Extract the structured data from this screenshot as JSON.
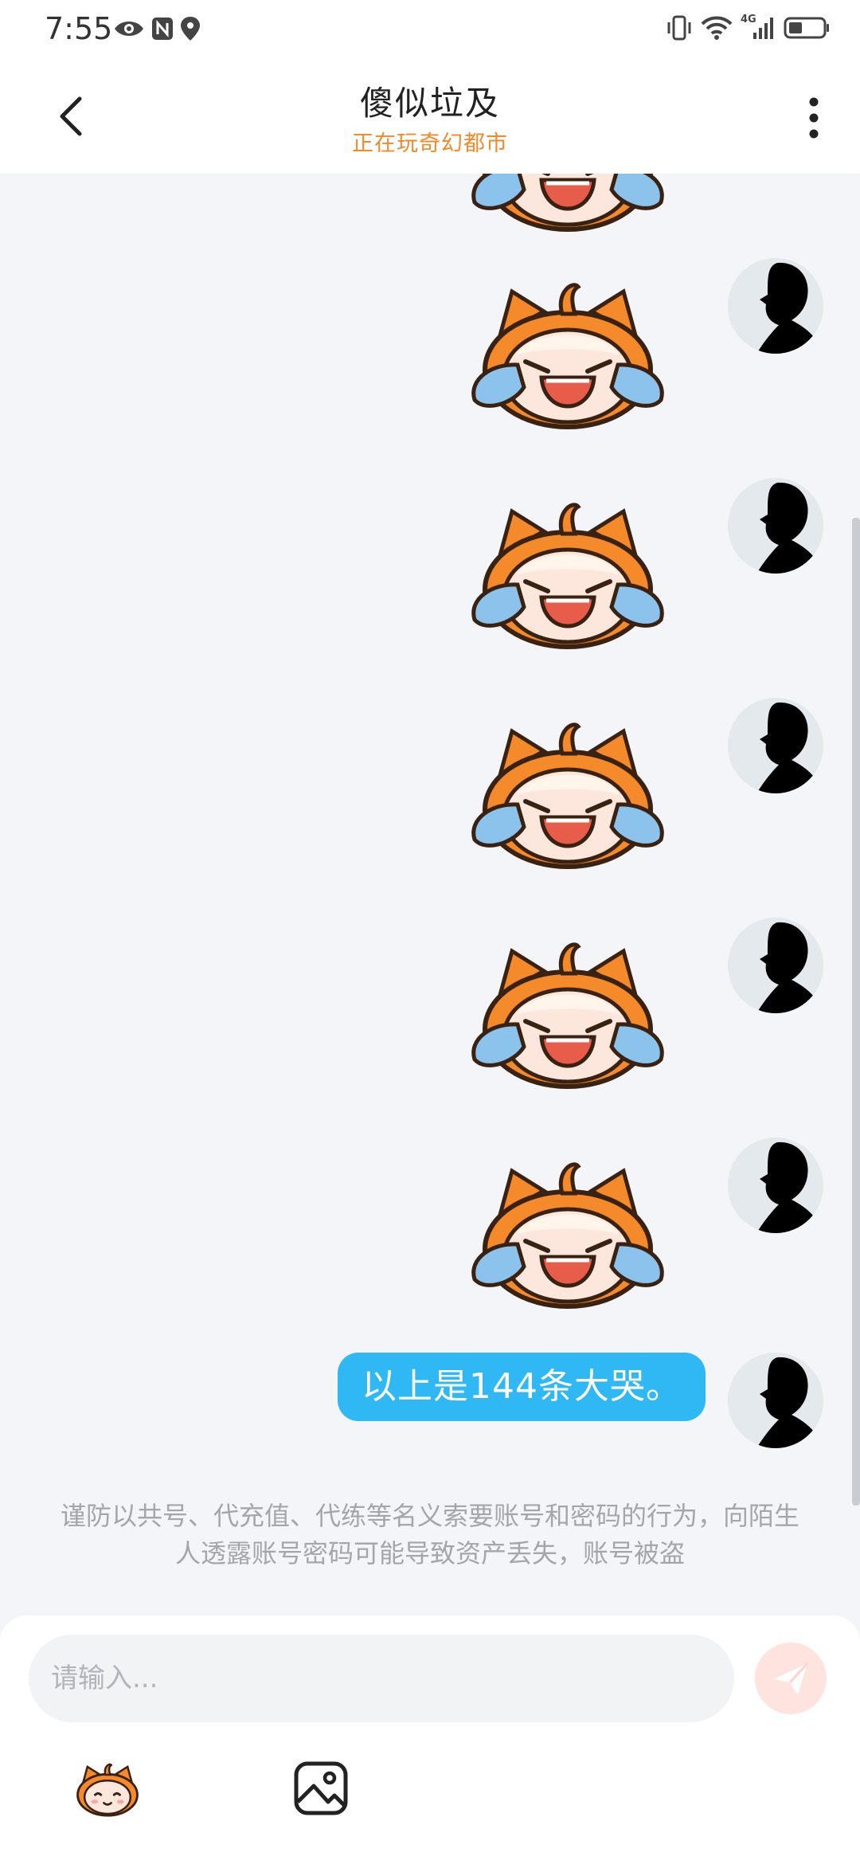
{
  "status_bar": {
    "time": "7:55",
    "left_icons": [
      "eye-icon",
      "nfc-icon",
      "location-icon"
    ],
    "right_icons": [
      "vibrate-icon",
      "wifi-icon",
      "signal-4g-icon",
      "battery-icon"
    ],
    "network_label": "4G"
  },
  "header": {
    "title": "傻似垃及",
    "subtitle": "正在玩奇幻都市",
    "subtitle_color": "#f08a2b"
  },
  "chat": {
    "messages": [
      {
        "type": "sticker",
        "sticker": "crying-mascot-sticker",
        "sender": "self"
      },
      {
        "type": "sticker",
        "sticker": "crying-mascot-sticker",
        "sender": "self"
      },
      {
        "type": "sticker",
        "sticker": "crying-mascot-sticker",
        "sender": "self"
      },
      {
        "type": "sticker",
        "sticker": "crying-mascot-sticker",
        "sender": "self"
      },
      {
        "type": "sticker",
        "sticker": "crying-mascot-sticker",
        "sender": "self"
      },
      {
        "type": "text",
        "text": "以上是144条大哭。",
        "sender": "self"
      }
    ],
    "bubble_color": "#2fb8f3",
    "notice": "谨防以共号、代充值、代练等名义索要账号和密码的行为，向陌生人透露账号密码可能导致资产丢失，账号被盗"
  },
  "composer": {
    "placeholder": "请输入...",
    "send_icon": "send-icon",
    "tools": [
      "emoji-sticker-icon",
      "image-icon"
    ]
  }
}
